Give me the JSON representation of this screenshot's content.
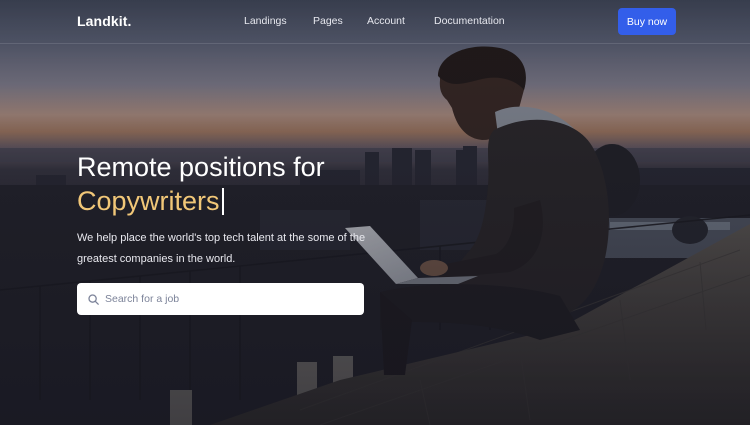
{
  "navbar": {
    "brand": "Landkit.",
    "links": [
      {
        "label": "Landings"
      },
      {
        "label": "Pages"
      },
      {
        "label": "Account"
      },
      {
        "label": "Documentation"
      }
    ],
    "cta_label": "Buy now",
    "cta_color": "#335eea"
  },
  "hero": {
    "heading_line1": "Remote positions for",
    "heading_accent": "Copywriters",
    "accent_color": "#f1c778",
    "lead": "We help place the world's top tech talent at the some of the greatest companies in the world."
  },
  "search": {
    "icon": "search-icon",
    "value": "",
    "placeholder": "Search for a job"
  }
}
